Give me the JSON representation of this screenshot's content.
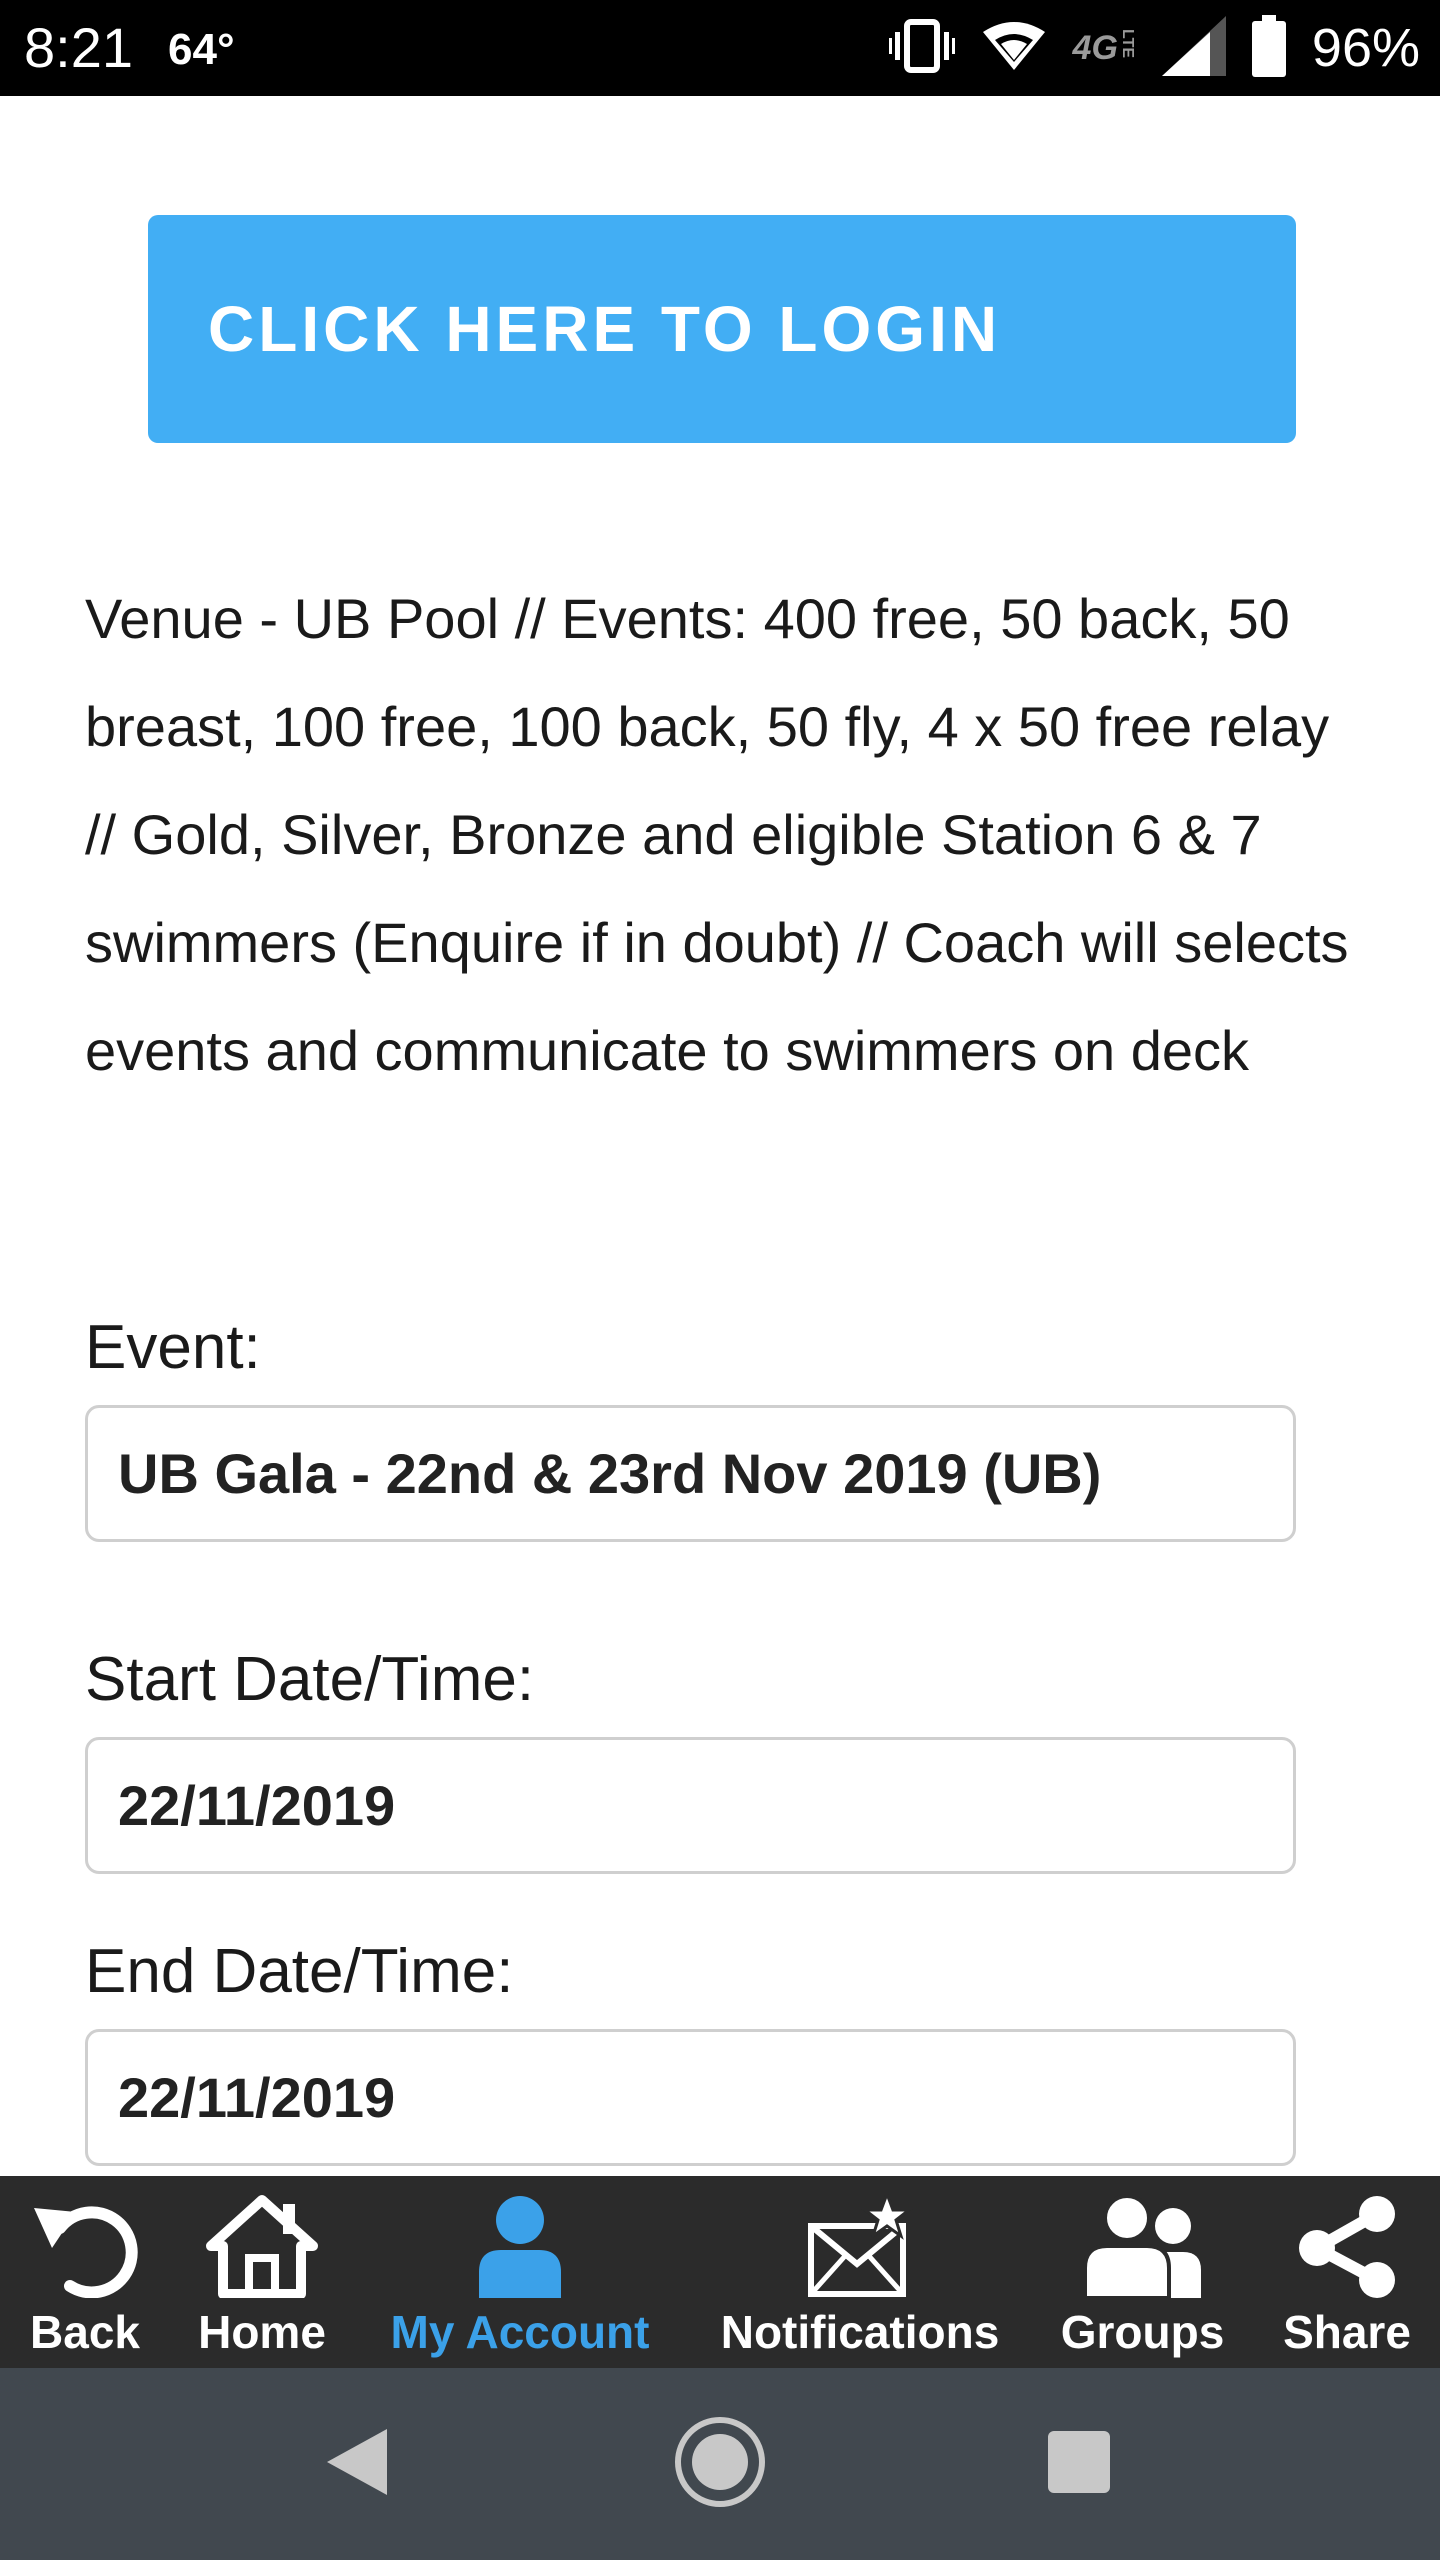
{
  "status_bar": {
    "time": "8:21",
    "temperature": "64°",
    "network": "4G",
    "network_sub": "LTE",
    "battery_percent": "96%",
    "icons": [
      "vibrate-icon",
      "wifi-icon",
      "signal-icon",
      "battery-icon"
    ]
  },
  "login_button": {
    "label": "CLICK HERE TO LOGIN",
    "color": "#42aef4"
  },
  "description": "Venue - UB Pool // Events: 400 free, 50 back, 50 breast, 100 free, 100 back, 50 fly, 4 x 50 free relay // Gold, Silver, Bronze and eligible Station 6 & 7 swimmers (Enquire if in doubt) // Coach will selects events and communicate to swimmers on deck",
  "form": {
    "event": {
      "label": "Event:",
      "value": "UB Gala - 22nd & 23rd Nov 2019 (UB)"
    },
    "start": {
      "label": "Start Date/Time:",
      "value": "22/11/2019"
    },
    "end": {
      "label": "End Date/Time:",
      "value": "22/11/2019"
    }
  },
  "toolbar": {
    "active_color": "#3ba1e9",
    "back": "Back",
    "home": "Home",
    "my_account": "My Account",
    "notifications": "Notifications",
    "groups": "Groups",
    "share": "Share"
  },
  "nav_bar": [
    "back-triangle-icon",
    "home-circle-icon",
    "recents-square-icon"
  ]
}
